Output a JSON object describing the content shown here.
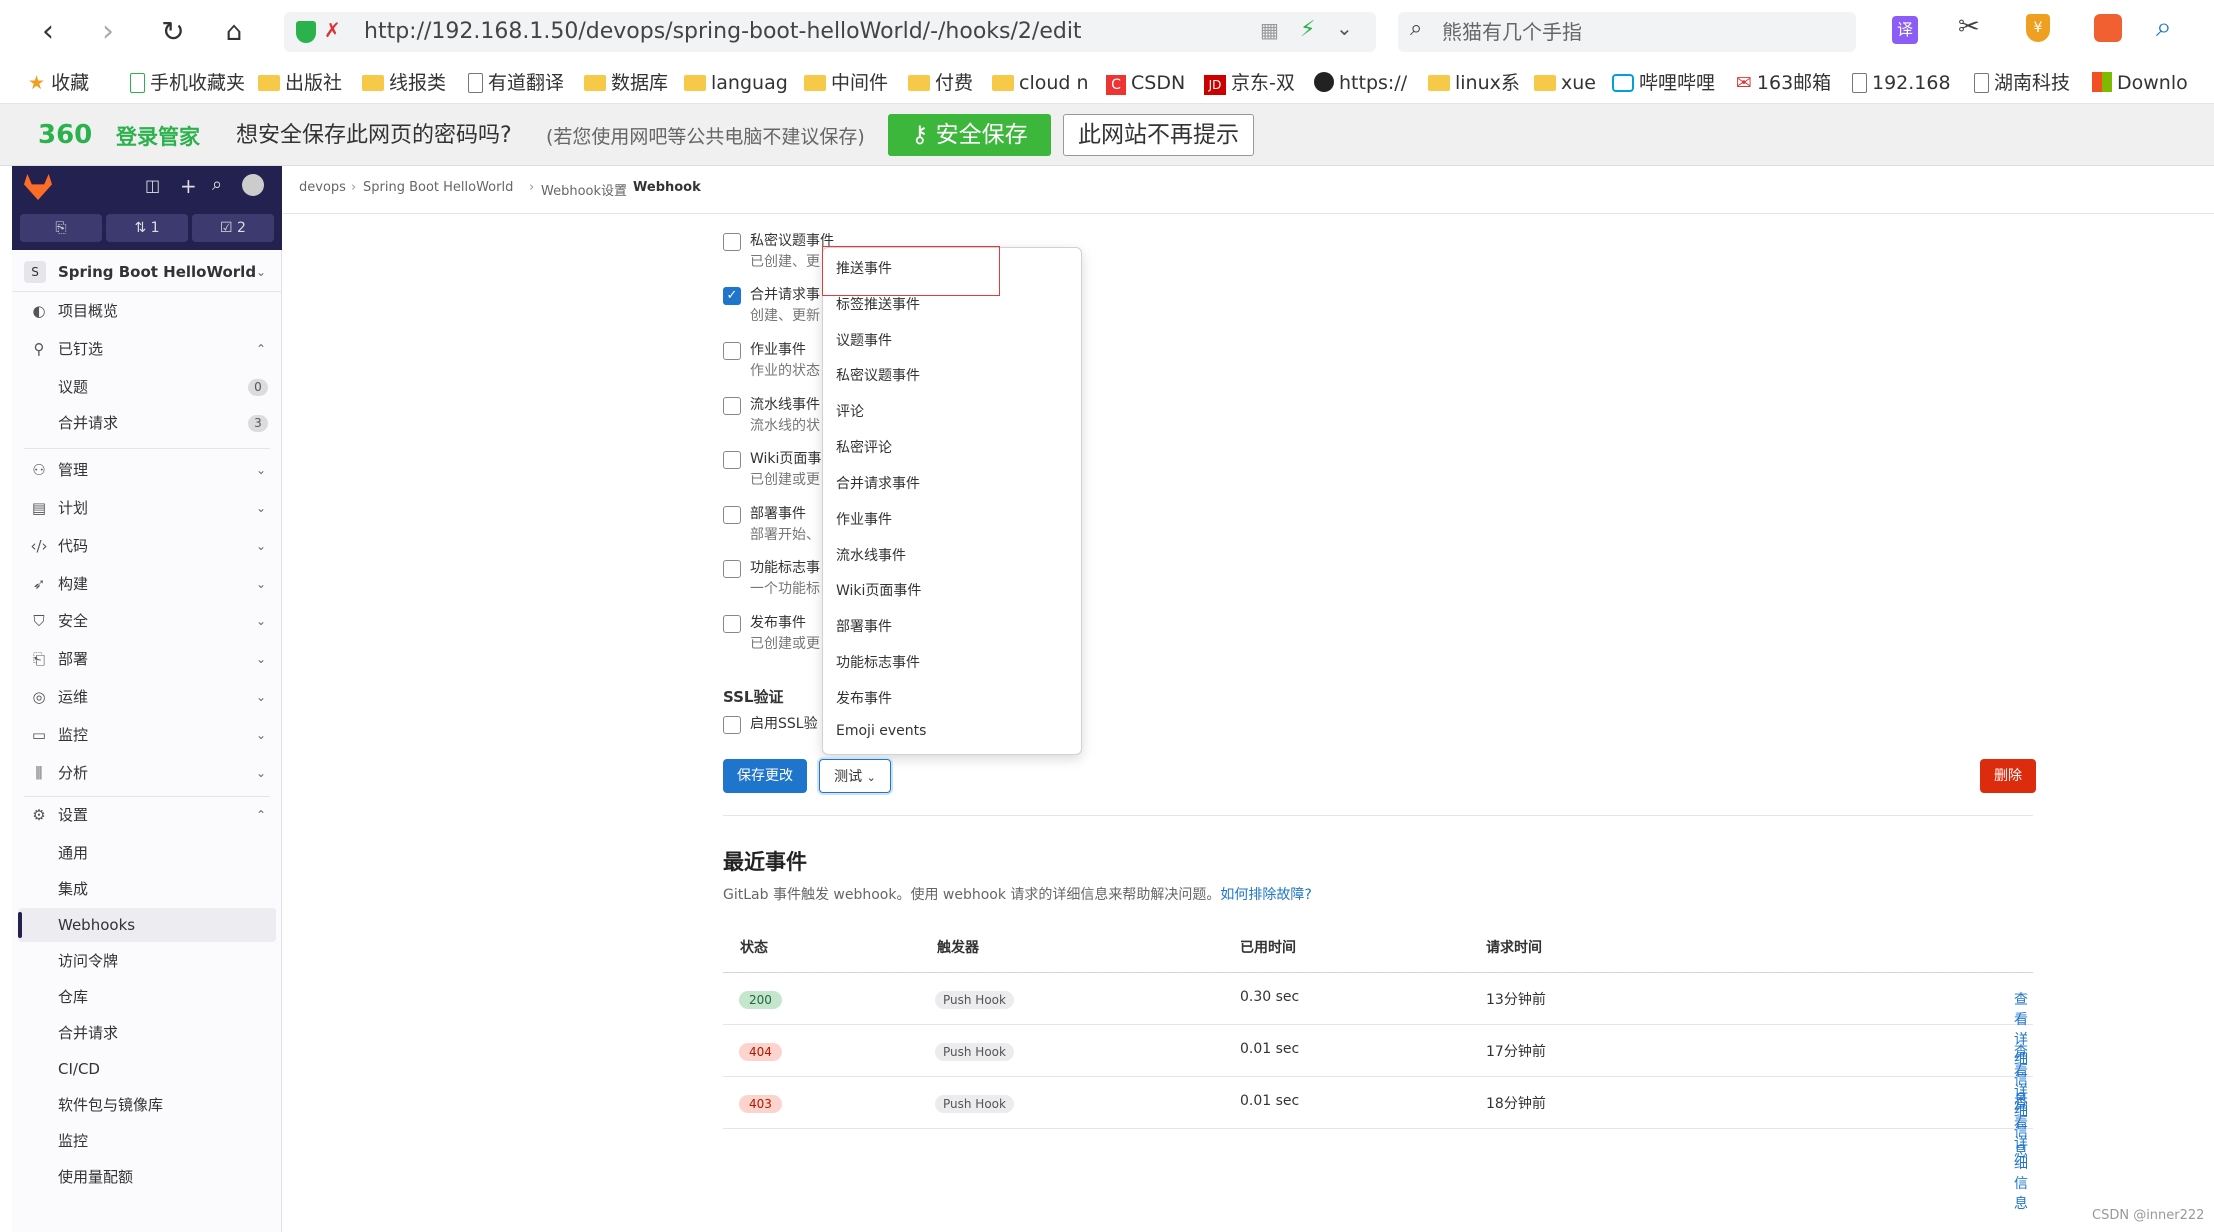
{
  "browser": {
    "url": "http://192.168.1.50/devops/spring-boot-helloWorld/-/hooks/2/edit",
    "search_placeholder": "熊猫有几个手指",
    "bookmarks": [
      "收藏",
      "手机收藏夹",
      "出版社",
      "线报类",
      "有道翻译",
      "数据库",
      "languag",
      "中间件",
      "付费",
      "cloud n",
      "CSDN",
      "京东-双",
      "https://",
      "linux系",
      "xue",
      "哔哩哔哩",
      "163邮箱",
      "192.168",
      "湖南科技",
      "Downlo"
    ],
    "password_bar": {
      "logo": "360",
      "brand": "登录管家",
      "question": "想安全保存此网页的密码吗?",
      "note": "(若您使用网吧等公共电脑不建议保存)",
      "save_button": "安全保存",
      "never_button": "此网站不再提示"
    }
  },
  "sidebar": {
    "counters": {
      "mr": "1",
      "todo": "2"
    },
    "project_initial": "S",
    "project_name": "Spring Boot HelloWorld",
    "overview": "项目概览",
    "pinned": "已钉选",
    "pinned_items": [
      {
        "label": "议题",
        "count": "0"
      },
      {
        "label": "合并请求",
        "count": "3"
      }
    ],
    "groups": [
      "管理",
      "计划",
      "代码",
      "构建",
      "安全",
      "部署",
      "运维",
      "监控",
      "分析"
    ],
    "settings": "设置",
    "settings_items": [
      "通用",
      "集成",
      "Webhooks",
      "访问令牌",
      "仓库",
      "合并请求",
      "CI/CD",
      "软件包与镜像库",
      "监控",
      "使用量配额"
    ]
  },
  "breadcrumb": [
    "devops",
    "Spring Boot HelloWorld",
    "Webhook设置",
    "Webhook"
  ],
  "events": [
    {
      "label": "私密议题事件",
      "desc": "已创建、更",
      "checked": false
    },
    {
      "label": "合并请求事",
      "desc": "创建、更新",
      "checked": true
    },
    {
      "label": "作业事件",
      "desc": "作业的状态",
      "checked": false
    },
    {
      "label": "流水线事件",
      "desc": "流水线的状",
      "checked": false
    },
    {
      "label": "Wiki页面事",
      "desc": "已创建或更",
      "checked": false
    },
    {
      "label": "部署事件",
      "desc": "部署开始、",
      "checked": false
    },
    {
      "label": "功能标志事",
      "desc": "一个功能标",
      "checked": false
    },
    {
      "label": "发布事件",
      "desc": "已创建或更",
      "checked": false
    }
  ],
  "ssl": {
    "title": "SSL验证",
    "label": "启用SSL验"
  },
  "dropdown_items": [
    "推送事件",
    "标签推送事件",
    "议题事件",
    "私密议题事件",
    "评论",
    "私密评论",
    "合并请求事件",
    "作业事件",
    "流水线事件",
    "Wiki页面事件",
    "部署事件",
    "功能标志事件",
    "发布事件",
    "Emoji events"
  ],
  "buttons": {
    "save": "保存更改",
    "test": "测试",
    "delete": "删除"
  },
  "recent": {
    "title": "最近事件",
    "desc": "GitLab 事件触发 webhook。使用 webhook 请求的详细信息来帮助解决问题。",
    "help_link": "如何排除故障?",
    "headers": [
      "状态",
      "触发器",
      "已用时间",
      "请求时间"
    ],
    "rows": [
      {
        "status": "200",
        "trigger": "Push Hook",
        "elapsed": "0.30 sec",
        "time": "13分钟前",
        "link": "查看详细信息"
      },
      {
        "status": "404",
        "trigger": "Push Hook",
        "elapsed": "0.01 sec",
        "time": "17分钟前",
        "link": "查看详细信息"
      },
      {
        "status": "403",
        "trigger": "Push Hook",
        "elapsed": "0.01 sec",
        "time": "18分钟前",
        "link": "查看详细信息"
      }
    ]
  },
  "watermark": "CSDN @inner222",
  "colors": {
    "primary": "#1f75cb",
    "danger": "#dd2b0e",
    "success_green": "#3cb73c",
    "sidebar_dark": "#232150"
  }
}
